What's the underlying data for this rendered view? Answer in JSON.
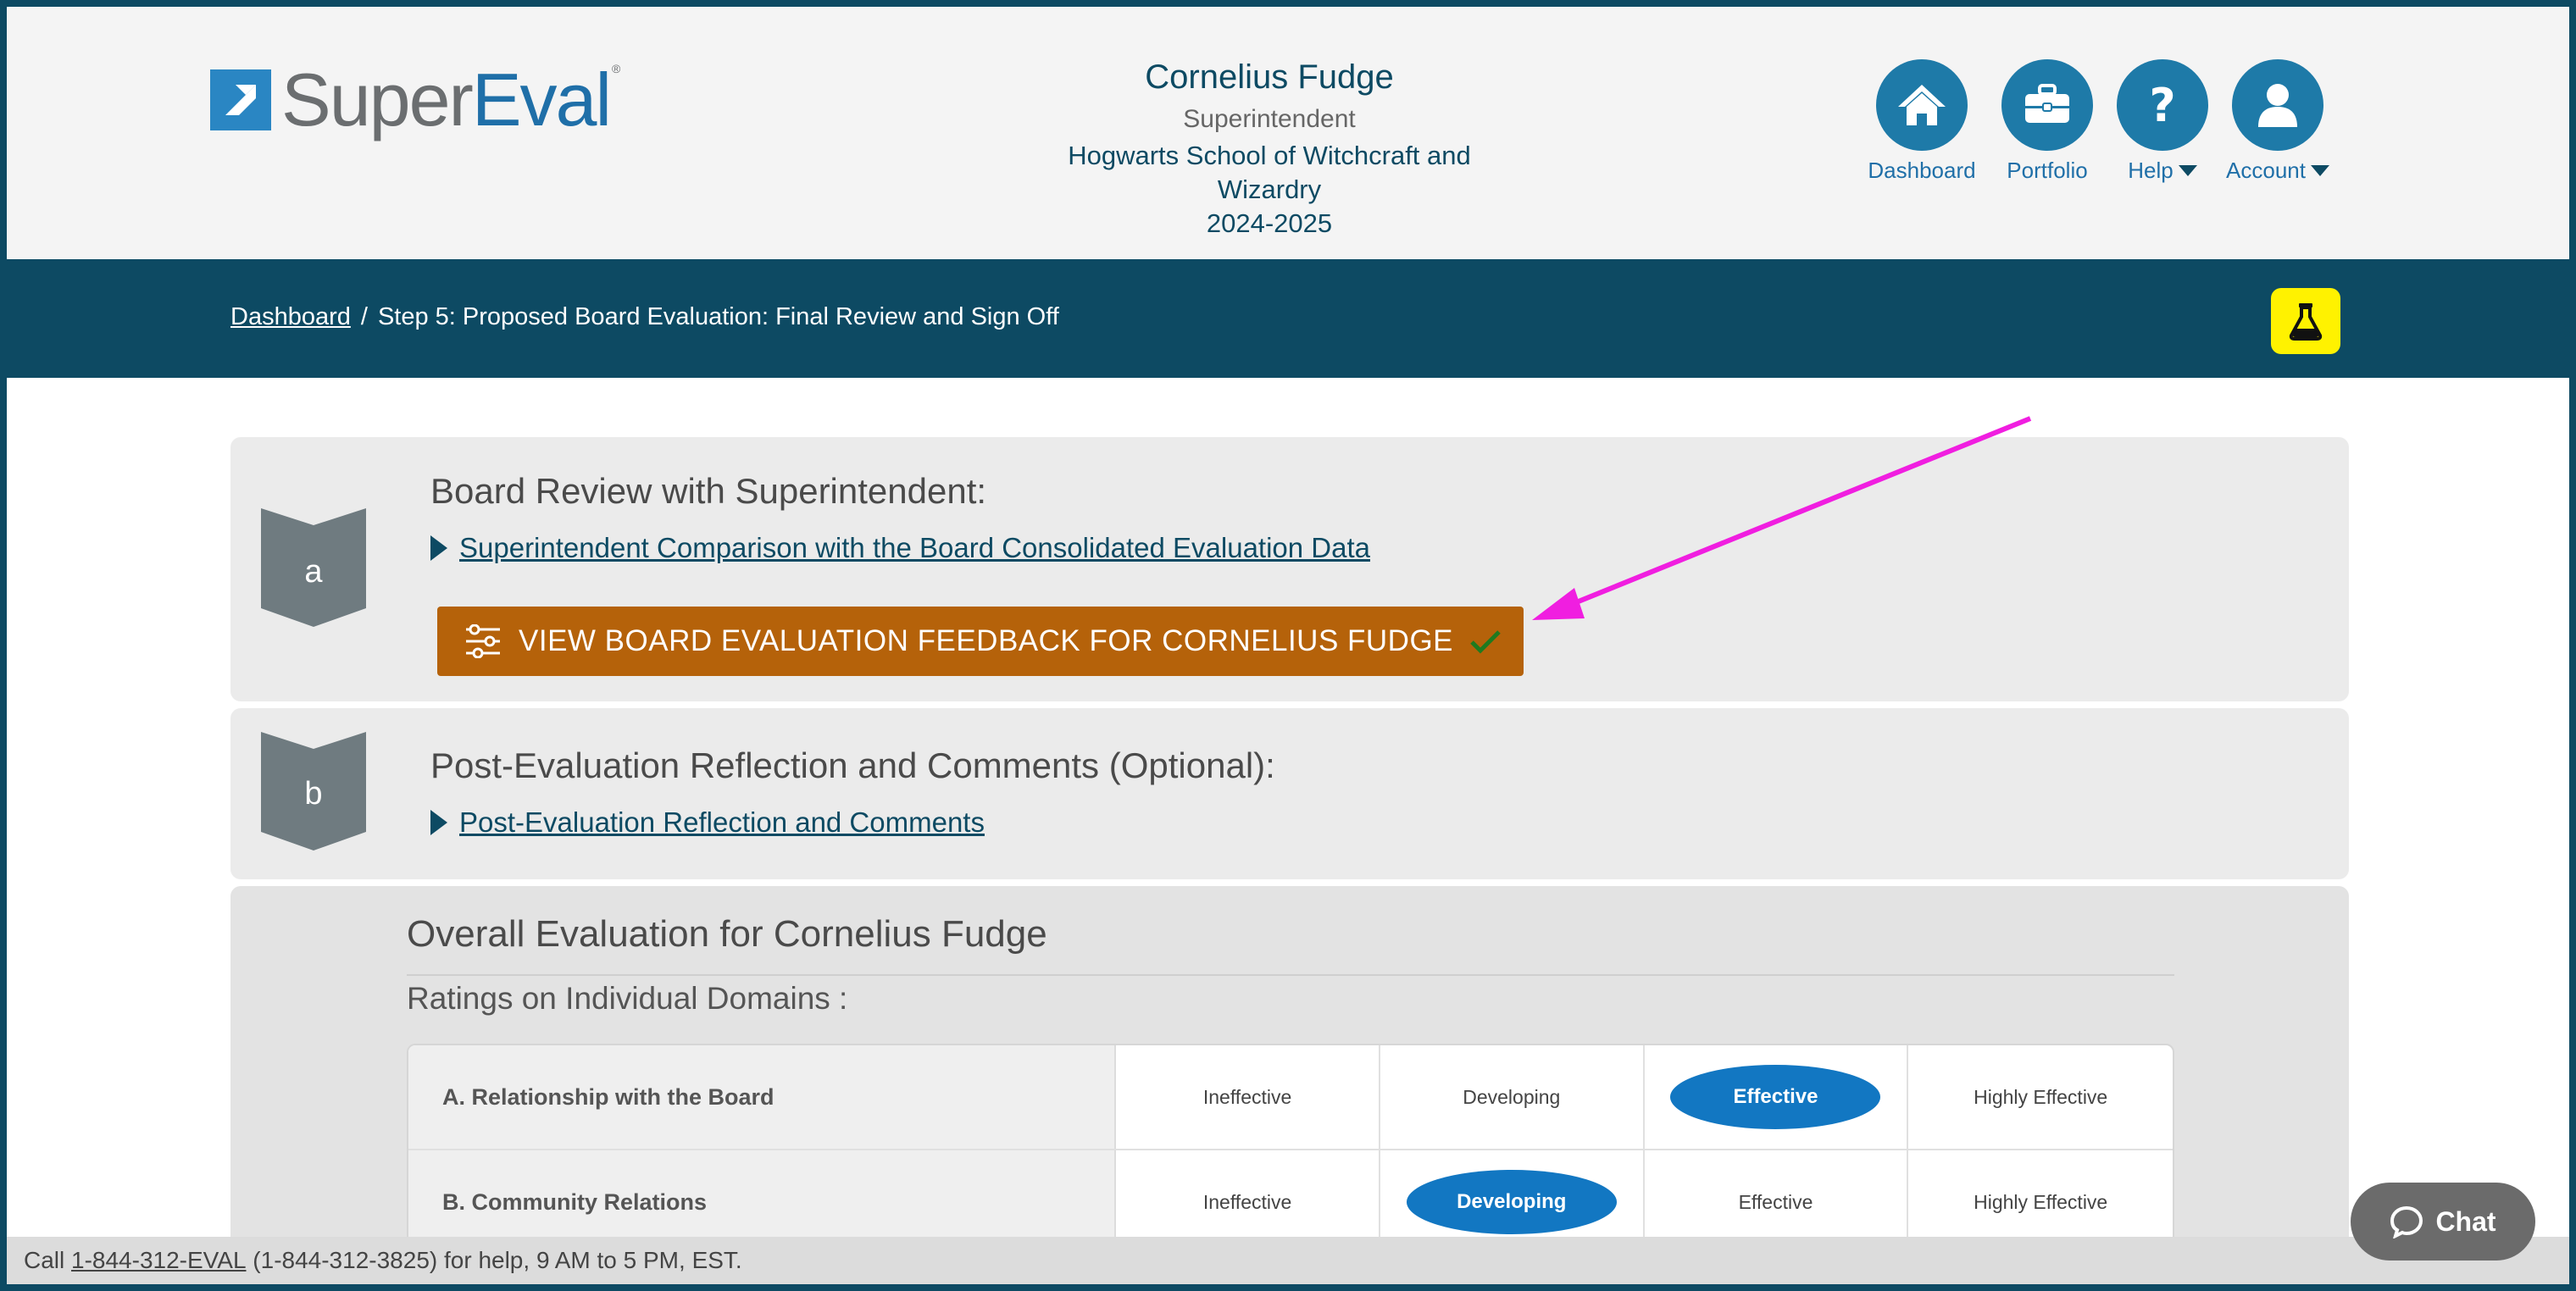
{
  "brand": {
    "name_part1": "Super",
    "name_part2": "Eval",
    "reg": "®"
  },
  "user": {
    "name": "Cornelius Fudge",
    "role": "Superintendent",
    "school_line1": "Hogwarts School of Witchcraft and",
    "school_line2": "Wizardry",
    "year": "2024-2025"
  },
  "nav": {
    "dashboard": "Dashboard",
    "portfolio": "Portfolio",
    "help": "Help",
    "account": "Account"
  },
  "breadcrumb": {
    "home": "Dashboard",
    "separator": "/",
    "current": "Step 5: Proposed Board Evaluation: Final Review and Sign Off"
  },
  "step_a": {
    "letter": "a",
    "title": "Board Review with Superintendent:",
    "link": "Superintendent Comparison with the Board Consolidated Evaluation Data",
    "button": "VIEW BOARD EVALUATION FEEDBACK FOR CORNELIUS FUDGE"
  },
  "step_b": {
    "letter": "b",
    "title": "Post-Evaluation Reflection and Comments (Optional):",
    "link": "Post-Evaluation Reflection and Comments"
  },
  "overall": {
    "title": "Overall Evaluation for Cornelius Fudge",
    "ratings_label": "Ratings on Individual Domains :",
    "levels": [
      "Ineffective",
      "Developing",
      "Effective",
      "Highly Effective"
    ],
    "domains": [
      {
        "name": "A. Relationship with the Board",
        "selected": "Effective"
      },
      {
        "name": "B. Community Relations",
        "selected": "Developing"
      }
    ]
  },
  "footer": {
    "prefix": "Call ",
    "phone": "1-844-312-EVAL",
    "suffix": " (1-844-312-3825) for help, 9 AM to 5 PM, EST."
  },
  "chat": {
    "label": "Chat"
  },
  "colors": {
    "navy": "#0d4a63",
    "accent_blue": "#1277c2",
    "button_orange": "#b5620a",
    "annotation_magenta": "#f01ee0",
    "lab_yellow": "#fff200"
  }
}
